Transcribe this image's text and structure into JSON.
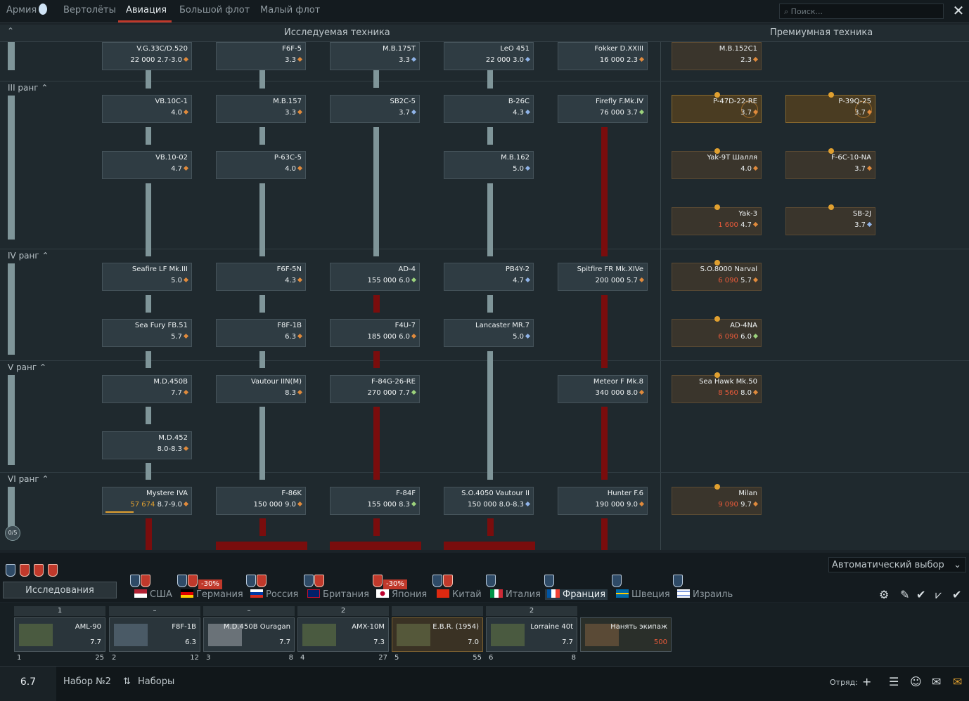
{
  "top_tabs": [
    "Армия",
    "Вертолёты",
    "Авиация",
    "Большой флот",
    "Малый флот"
  ],
  "search_placeholder": "Поиск...",
  "sections": {
    "researched": "Исследуемая техника",
    "premium": "Премиумная техника"
  },
  "ranks": [
    "III ранг",
    "IV ранг",
    "V ранг",
    "VI ранг"
  ],
  "rank_counter": "0/5",
  "vehicles": {
    "r2": [
      {
        "name": "V.G.33C/D.520",
        "cost": "22 000",
        "br": "2.7-3.0"
      },
      {
        "name": "F6F-5",
        "br": "3.3"
      },
      {
        "name": "M.B.175T",
        "br": "3.3"
      },
      {
        "name": "LeO 451",
        "cost": "22 000",
        "br": "3.0"
      },
      {
        "name": "Fokker D.XXIII",
        "cost": "16 000",
        "br": "2.3"
      },
      {
        "name": "M.B.152C1",
        "br": "2.3"
      }
    ],
    "r3a": [
      {
        "name": "VB.10C-1",
        "br": "4.0"
      },
      {
        "name": "M.B.157",
        "br": "3.3"
      },
      {
        "name": "SB2C-5",
        "br": "3.7"
      },
      {
        "name": "B-26C",
        "br": "4.3"
      },
      {
        "name": "Firefly F.Mk.IV",
        "cost": "76 000",
        "br": "3.7"
      },
      {
        "name": "P-47D-22-RE",
        "br": "3.7"
      },
      {
        "name": "P-39Q-25",
        "br": "3.7"
      }
    ],
    "r3b": [
      {
        "name": "VB.10-02",
        "br": "4.7"
      },
      {
        "name": "P-63C-5",
        "br": "4.0"
      },
      {
        "name": "M.B.162",
        "br": "5.0"
      },
      {
        "name": "Yak-9T Шалля",
        "br": "4.0"
      },
      {
        "name": "F-6C-10-NA",
        "br": "3.7"
      }
    ],
    "r3c": [
      {
        "name": "Yak-3",
        "cost": "1 600",
        "br": "4.7"
      },
      {
        "name": "SB-2J",
        "br": "3.7"
      }
    ],
    "r4a": [
      {
        "name": "Seafire LF Mk.III",
        "br": "5.0"
      },
      {
        "name": "F6F-5N",
        "br": "4.3"
      },
      {
        "name": "AD-4",
        "cost": "155 000",
        "br": "6.0"
      },
      {
        "name": "PB4Y-2",
        "br": "4.7"
      },
      {
        "name": "Spitfire FR Mk.XIVe",
        "cost": "200 000",
        "br": "5.7"
      },
      {
        "name": "S.O.8000 Narval",
        "cost": "6 090",
        "br": "5.7"
      }
    ],
    "r4b": [
      {
        "name": "Sea Fury FB.51",
        "br": "5.7"
      },
      {
        "name": "F8F-1B",
        "br": "6.3"
      },
      {
        "name": "F4U-7",
        "cost": "185 000",
        "br": "6.0"
      },
      {
        "name": "Lancaster MR.7",
        "br": "5.0"
      },
      {
        "name": "AD-4NA",
        "cost": "6 090",
        "br": "6.0"
      }
    ],
    "r5a": [
      {
        "name": "M.D.450B",
        "br": "7.7"
      },
      {
        "name": "Vautour IIN(M)",
        "br": "8.3"
      },
      {
        "name": "F-84G-26-RE",
        "cost": "270 000",
        "br": "7.7"
      },
      {
        "name": "Meteor F Mk.8",
        "cost": "340 000",
        "br": "8.0"
      },
      {
        "name": "Sea Hawk Mk.50",
        "cost": "8 560",
        "br": "8.0"
      }
    ],
    "r5b": [
      {
        "name": "M.D.452",
        "br": "8.0-8.3"
      }
    ],
    "r6": [
      {
        "name": "Mystere IVA",
        "cost": "57 674",
        "br": "8.7-9.0"
      },
      {
        "name": "F-86K",
        "cost": "150 000",
        "br": "9.0"
      },
      {
        "name": "F-84F",
        "cost": "155 000",
        "br": "8.3"
      },
      {
        "name": "S.O.4050 Vautour II",
        "cost": "150 000",
        "br": "8.0-8.3"
      },
      {
        "name": "Hunter F.6",
        "cost": "190 000",
        "br": "9.0"
      },
      {
        "name": "Milan",
        "cost": "9 090",
        "br": "9.7"
      }
    ]
  },
  "bottom": {
    "research_label": "Исследования",
    "auto_select": "Автоматический выбор",
    "nations": [
      "США",
      "Германия",
      "Россия",
      "Британия",
      "Япония",
      "Китай",
      "Италия",
      "Франция",
      "Швеция",
      "Израиль"
    ],
    "discount": "-30%",
    "crew": [
      {
        "head": "1",
        "name": "AML-90",
        "br": "7.7",
        "num": "1",
        "cost": "25"
      },
      {
        "head": "–",
        "name": "F8F-1B",
        "br": "6.3",
        "num": "2",
        "cost": "12"
      },
      {
        "head": "–",
        "name": "M.D.450B Ouragan",
        "br": "7.7",
        "num": "3",
        "cost": "8"
      },
      {
        "head": "2",
        "name": "AMX-10M",
        "br": "7.3",
        "num": "4",
        "cost": "27"
      },
      {
        "head": "",
        "name": "E.B.R. (1954)",
        "br": "7.0",
        "num": "5",
        "cost": "55"
      },
      {
        "head": "2",
        "name": "Lorraine 40t",
        "br": "7.7",
        "num": "6",
        "cost": "8"
      }
    ],
    "hire_label": "Нанять экипаж",
    "hire_cost": "500",
    "br_value": "6.7",
    "preset_name": "Набор №2",
    "presets_label": "Наборы",
    "squad_label": "Отряд:"
  },
  "colors": {
    "accent": "#c0392b",
    "link": "#7f9599",
    "locked_link": "#7a0d0d"
  }
}
